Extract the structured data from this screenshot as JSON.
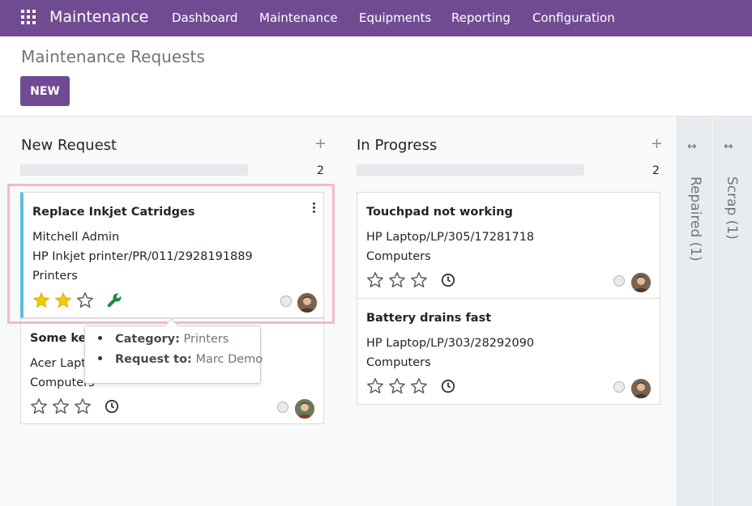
{
  "navbar": {
    "brand": "Maintenance",
    "menu": [
      "Dashboard",
      "Maintenance",
      "Equipments",
      "Reporting",
      "Configuration"
    ],
    "color": "#714b92"
  },
  "control": {
    "title": "Maintenance Requests",
    "new_label": "NEW"
  },
  "columns": [
    {
      "title": "New Request",
      "count": "2",
      "cards": [
        {
          "title": "Replace Inkjet Catridges",
          "lines": [
            "Mitchell Admin",
            "HP Inkjet printer/PR/011/2928191889",
            "Printers"
          ],
          "priority": 2,
          "icon": "wrench-icon"
        },
        {
          "title": "Some keys are not working",
          "lines": [
            "Acer Laptop/LP/203/19281928",
            "Computers"
          ],
          "priority": 0,
          "icon": "clock-icon"
        }
      ]
    },
    {
      "title": "In Progress",
      "count": "2",
      "cards": [
        {
          "title": "Touchpad not working",
          "lines": [
            "HP Laptop/LP/305/17281718",
            "Computers"
          ],
          "priority": 0,
          "icon": "clock-icon"
        },
        {
          "title": "Battery drains fast",
          "lines": [
            "HP Laptop/LP/303/28292090",
            "Computers"
          ],
          "priority": 0,
          "icon": "clock-icon"
        }
      ]
    }
  ],
  "folded_columns": [
    {
      "label": "Repaired (1)"
    },
    {
      "label": "Scrap (1)"
    }
  ],
  "tooltip": {
    "category_label": "Category:",
    "category_value": "Printers",
    "request_label": "Request to:",
    "request_value": "Marc Demo"
  },
  "colors": {
    "star_filled": "#f3cc00",
    "star_empty": "#5c5c5c",
    "wrench": "#1f8a3a",
    "card_accent": "#5bc0de",
    "highlight": "#f6b6cf"
  }
}
